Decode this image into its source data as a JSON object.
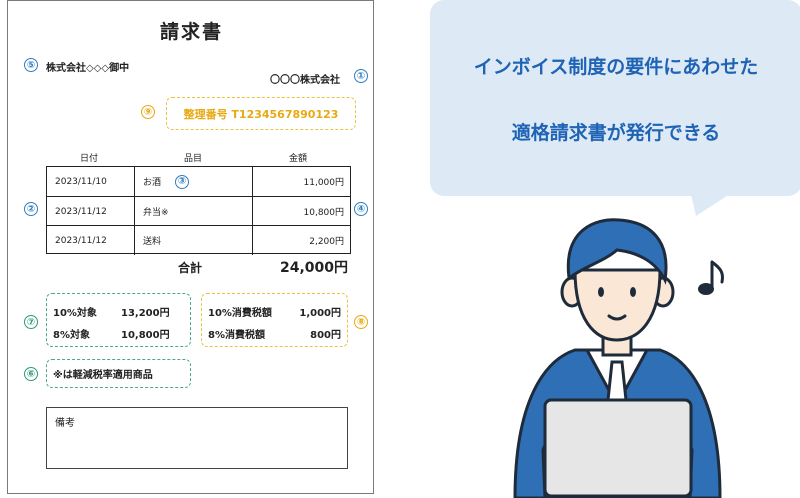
{
  "invoice": {
    "title": "請求書",
    "recipient": "株式会社◇◇◇御中",
    "issuer": "〇〇〇株式会社",
    "registration": "整理番号 T1234567890123",
    "headers": [
      "日付",
      "品目",
      "金額"
    ],
    "rows": [
      {
        "date": "2023/11/10",
        "item": "お酒",
        "amount": "11,000円"
      },
      {
        "date": "2023/11/12",
        "item": "弁当※",
        "amount": "10,800円"
      },
      {
        "date": "2023/11/12",
        "item": "送料",
        "amount": "2,200円"
      }
    ],
    "total_label": "合計",
    "total_value": "24,000円",
    "tax_targets": {
      "r10_label": "10%対象",
      "r10_value": "13,200円",
      "r8_label": "8%対象",
      "r8_value": "10,800円"
    },
    "tax_amounts": {
      "r10_label": "10%消費税額",
      "r10_value": "1,000円",
      "r8_label": "8%消費税額",
      "r8_value": "800円"
    },
    "reduced_note": "※は軽減税率適用商品",
    "remarks_label": "備考",
    "markers": [
      "①",
      "②",
      "③",
      "④",
      "⑤",
      "⑥",
      "⑦",
      "⑧",
      "⑨"
    ]
  },
  "bubble": {
    "line1": "インボイス制度の要件にあわせた",
    "line2": "適格請求書が発行できる"
  },
  "colors": {
    "blue": "#2f7fc1",
    "yellow": "#e8a912",
    "green": "#2e9a7a",
    "bubble_bg": "#ddeaf6",
    "bubble_text": "#1f63b5",
    "suit": "#2f6fb5"
  },
  "icons": [
    "music-note-icon",
    "businessman-illustration",
    "laptop-icon"
  ]
}
